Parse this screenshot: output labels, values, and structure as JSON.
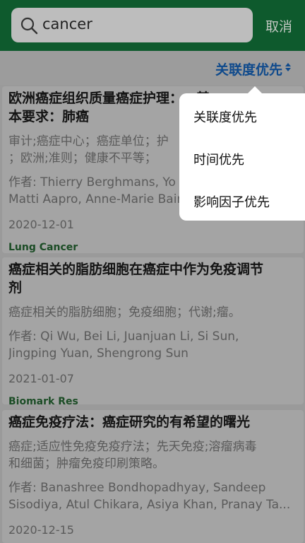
{
  "search": {
    "query": "cancer",
    "cancel_label": "取消"
  },
  "sort": {
    "current": "关联度优先",
    "options": [
      "关联度优先",
      "时间优先",
      "影响因子优先"
    ]
  },
  "articles": [
    {
      "title_line1": "欧洲癌症组织质量癌症护理：…基",
      "title_line2": "本要求：肺癌",
      "keywords_line1": "审计;癌症中心；癌症单位；护",
      "keywords_line2": "；欧洲;准则；健康不平等；",
      "authors_line1": "作者: Thierry Berghmans, Yo",
      "authors_line2": "Matti Aapro, Anne-Marie Bain",
      "date": "2020-12-01",
      "journal": "Lung Cancer"
    },
    {
      "title_line1": "癌症相关的脂肪细胞在癌症中作为免疫调节",
      "title_line2": "剂",
      "keywords_line1": "癌症相关的脂肪细胞；免疫细胞；代谢;瘤。",
      "authors_line1": "作者: Qi Wu, Bei Li, Juanjuan Li, Si Sun,",
      "authors_line2": "Jingping Yuan, Shengrong Sun",
      "date": "2021-01-07",
      "journal": "Biomark Res"
    },
    {
      "title_line1": "癌症免疫疗法：癌症研究的有希望的曙光",
      "keywords_line1": "癌症;适应性免疫免疫疗法；先天免疫;溶瘤病毒",
      "keywords_line2": "和细菌；肿瘤免疫印刷策略。",
      "authors_line1": "作者: Banashree Bondhopadhyay, Sandeep",
      "authors_line2": "Sisodiya, Atul Chikara, Asiya Khan, Pranay Ta...",
      "date": "2020-12-15"
    }
  ],
  "colors": {
    "header_bg": "#0e5a2d",
    "sort_label": "#0f4a8c",
    "journal": "#1b4c25"
  }
}
